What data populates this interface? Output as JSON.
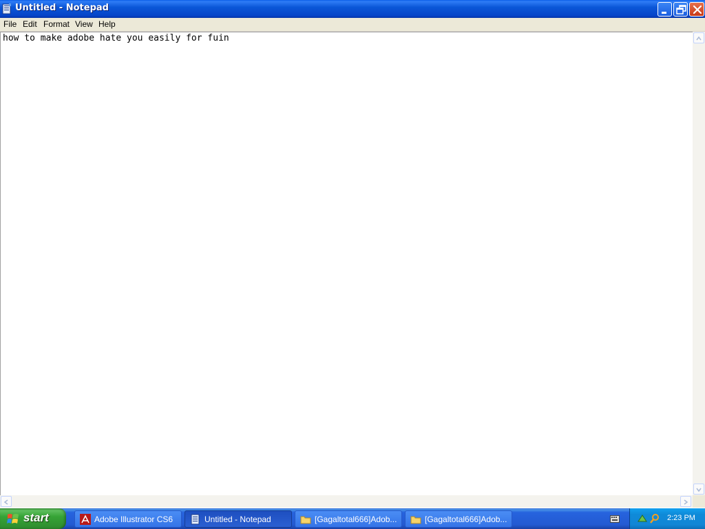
{
  "window": {
    "title": "Untitled - Notepad",
    "icon": "notepad-icon",
    "controls": [
      "minimize-icon",
      "restore-icon",
      "close-icon"
    ]
  },
  "menu": {
    "items": [
      {
        "label": "File"
      },
      {
        "label": "Edit"
      },
      {
        "label": "Format"
      },
      {
        "label": "View"
      },
      {
        "label": "Help"
      }
    ]
  },
  "editor": {
    "text": "how to make adobe hate you easily for fuin"
  },
  "taskbar": {
    "start_label": "start",
    "tasks": [
      {
        "label": "Adobe Illustrator CS6",
        "icon": "adobe-icon",
        "active": false
      },
      {
        "label": "Untitled - Notepad",
        "icon": "notepad-icon",
        "active": true
      },
      {
        "label": "[Gagaltotal666]Adob...",
        "icon": "folder-icon",
        "active": false
      },
      {
        "label": "[Gagaltotal666]Adob...",
        "icon": "folder-icon",
        "active": false
      }
    ],
    "clock": "2:23 PM"
  },
  "colors": {
    "titlebar": "#0b57d8",
    "taskbar": "#235ad2",
    "start": "#36a336",
    "tray": "#0f8ad8",
    "menubar": "#ece9d8"
  }
}
